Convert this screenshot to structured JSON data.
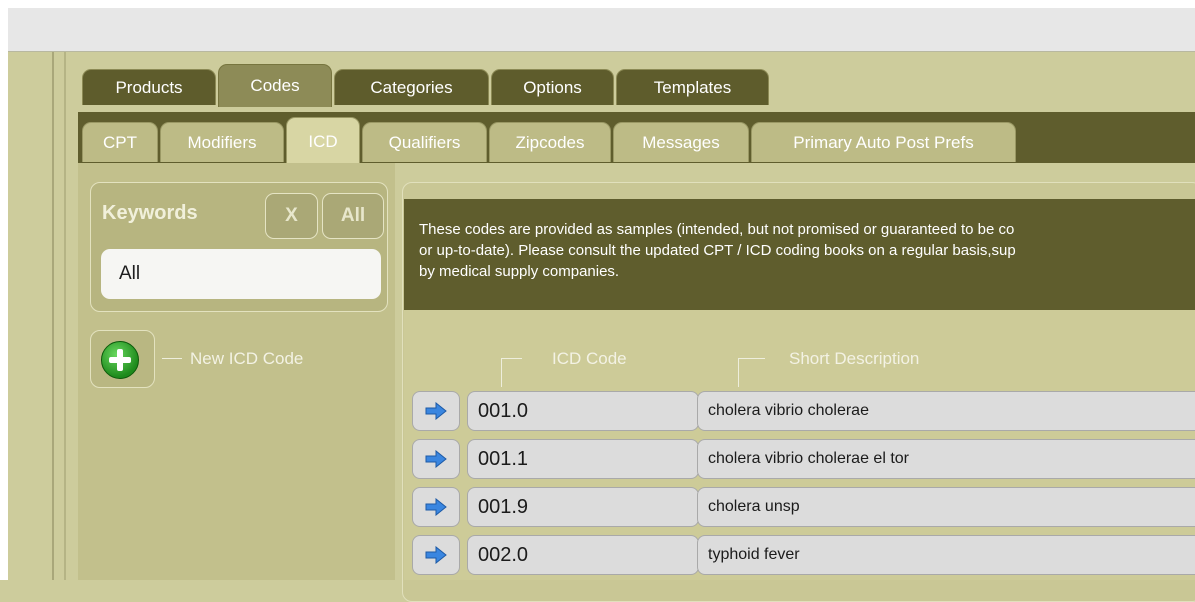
{
  "main_tabs": [
    {
      "label": "Products",
      "active": false
    },
    {
      "label": "Codes",
      "active": true
    },
    {
      "label": "Categories",
      "active": false
    },
    {
      "label": "Options",
      "active": false
    },
    {
      "label": "Templates",
      "active": false
    }
  ],
  "sub_tabs": [
    {
      "label": "CPT",
      "active": false
    },
    {
      "label": "Modifiers",
      "active": false
    },
    {
      "label": "ICD",
      "active": true
    },
    {
      "label": "Qualifiers",
      "active": false
    },
    {
      "label": "Zipcodes",
      "active": false
    },
    {
      "label": "Messages",
      "active": false
    },
    {
      "label": "Primary Auto Post Prefs",
      "active": false
    }
  ],
  "keywords": {
    "label": "Keywords",
    "clear_label": "X",
    "all_label": "All",
    "value": "All"
  },
  "new_code": {
    "label": "New ICD Code",
    "icon": "add-circle-icon"
  },
  "notice": {
    "lines": [
      "These codes are provided as samples (intended, but not promised or guaranteed to be co",
      "or up-to-date). Please consult the updated CPT / ICD coding books on a regular basis,sup",
      "by medical supply companies."
    ]
  },
  "table": {
    "columns": [
      "ICD Code",
      "Short Description"
    ],
    "rows": [
      {
        "code": "001.0",
        "description": "cholera vibrio cholerae"
      },
      {
        "code": "001.1",
        "description": "cholera vibrio cholerae el tor"
      },
      {
        "code": "001.9",
        "description": "cholera unsp"
      },
      {
        "code": "002.0",
        "description": "typhoid fever"
      }
    ],
    "row_icon": "arrow-right-icon"
  },
  "colors": {
    "background": "#cdcc9c",
    "dark_olive": "#5f5d2d",
    "accent_blue": "#3a86e0"
  }
}
